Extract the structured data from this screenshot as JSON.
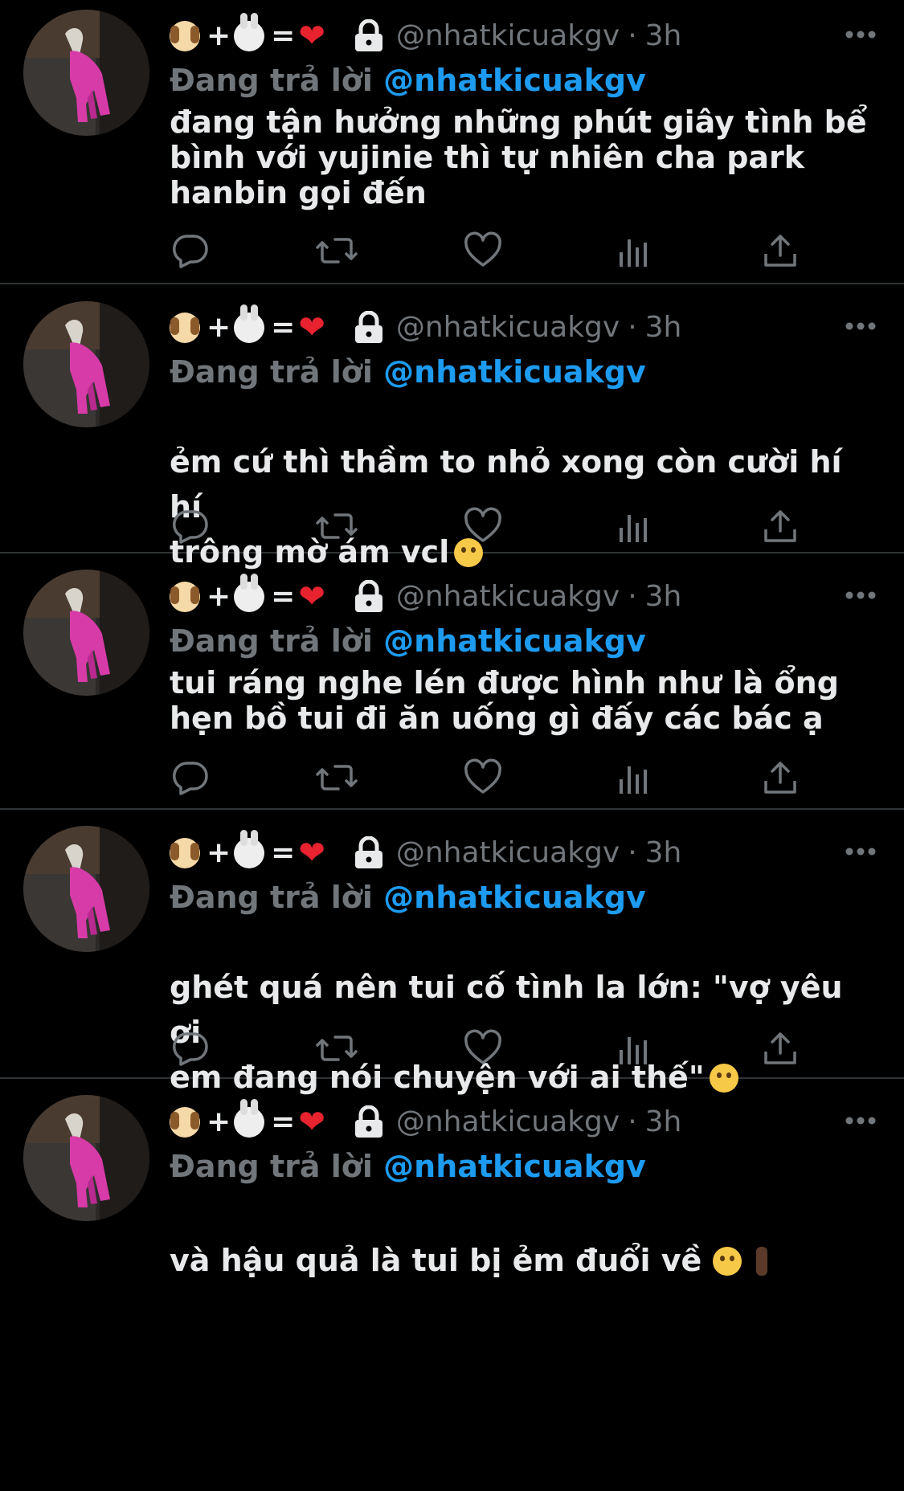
{
  "theme": {
    "background": "#000000",
    "text": "#e7e9ea",
    "muted": "#71767b",
    "link": "#1d9bf0",
    "divider": "#2f3336",
    "heart": "#e8232f"
  },
  "author": {
    "emoji_name": [
      "dog-face-emoji",
      "plus",
      "rabbit-face-emoji",
      "equals",
      "red-heart-emoji"
    ],
    "plus_symbol": "+",
    "equals_symbol": "=",
    "heart_symbol": "❤",
    "handle": "@nhatkicuakgv",
    "separator": "·",
    "time": "3h",
    "protected_icon": "lock-icon"
  },
  "reply": {
    "prefix": "Đang trả lời",
    "handle": "@nhatkicuakgv"
  },
  "tweets": [
    {
      "text": "đang tận hưởng những phút giây tình bể\nbình với yujinie thì tự nhiên cha park\nhanbin gọi đến",
      "emoji": []
    },
    {
      "text": "ẻm cứ thì thầm to nhỏ xong còn cười hí hí\ntrông mờ ám vcl",
      "emoji": [
        "pleading-face-emoji"
      ]
    },
    {
      "text": "tui ráng nghe lén được hình như là ổng\nhẹn bồ tui đi ăn uống gì đấy các bác ạ",
      "emoji": []
    },
    {
      "text": "ghét quá nên tui cố tình la lớn: \"vợ yêu ơi\nem đang nói chuyện với ai thế\"",
      "emoji": [
        "smirking-face-emoji"
      ]
    },
    {
      "text": "và hậu quả là tui bị ẻm đuổi về",
      "emoji": [
        "star-struck-emoji",
        "middle-finger-emoji"
      ]
    }
  ],
  "actions": [
    "reply-icon",
    "retweet-icon",
    "like-icon",
    "views-icon",
    "share-icon"
  ]
}
